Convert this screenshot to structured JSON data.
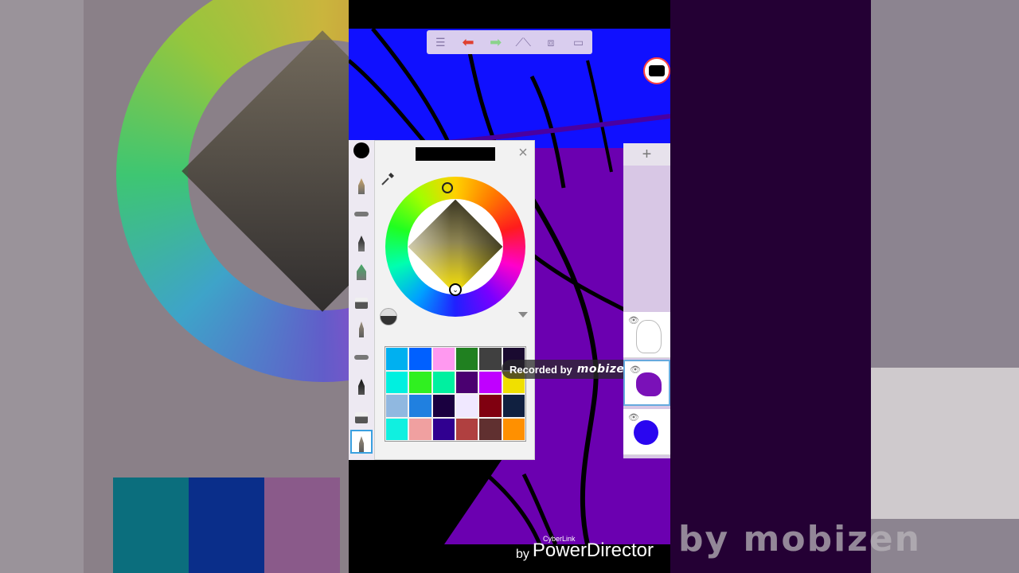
{
  "top_toolbar": {
    "icons": [
      "list-icon",
      "undo-icon",
      "redo-icon",
      "ruler-icon",
      "symmetry-icon",
      "fullscreen-icon"
    ],
    "undo_color": "#e04030",
    "redo_color": "#8bd38b"
  },
  "color_picker": {
    "current_color": "#000000",
    "close_glyph": "×",
    "swatches": [
      "#00b0f0",
      "#0060ff",
      "#ff99f0",
      "#208020",
      "#404040",
      "#1a0a30",
      "#00f0e0",
      "#30f020",
      "#00f0a0",
      "#4a0070",
      "#c000ff",
      "#f0e000",
      "#90b8e0",
      "#2080e0",
      "#1a0040",
      "#f0e8ff",
      "#800010",
      "#102040",
      "#10f0e0",
      "#f0a0a0",
      "#300090",
      "#b04040",
      "#603030",
      "#ff9000"
    ]
  },
  "tools": [
    {
      "name": "pencil-tool",
      "kind": "pen"
    },
    {
      "name": "airbrush-tool",
      "kind": "flat"
    },
    {
      "name": "marker-tool",
      "kind": "pen"
    },
    {
      "name": "paintbrush-tool",
      "kind": "pen"
    },
    {
      "name": "eraser-tool",
      "kind": "eraser"
    },
    {
      "name": "fine-pen-tool",
      "kind": "pen"
    },
    {
      "name": "soft-airbrush-tool",
      "kind": "flat"
    },
    {
      "name": "ink-pen-tool",
      "kind": "pen"
    },
    {
      "name": "soft-eraser-tool",
      "kind": "eraser"
    },
    {
      "name": "smudge-tool",
      "kind": "pen",
      "active": true
    }
  ],
  "layers_panel": {
    "add_glyph": "+",
    "layers": [
      {
        "kind": "sketch",
        "visible": true,
        "selected": false
      },
      {
        "kind": "blob",
        "visible": true,
        "selected": true
      },
      {
        "kind": "circle",
        "visible": true,
        "selected": false
      }
    ]
  },
  "overlay": {
    "recorded_by": "Recorded by",
    "recorder_brand": "mobizen"
  },
  "watermark": {
    "small": "CyberLink",
    "by": "by",
    "brand": "PowerDirector",
    "side_text": "by mobizen"
  }
}
